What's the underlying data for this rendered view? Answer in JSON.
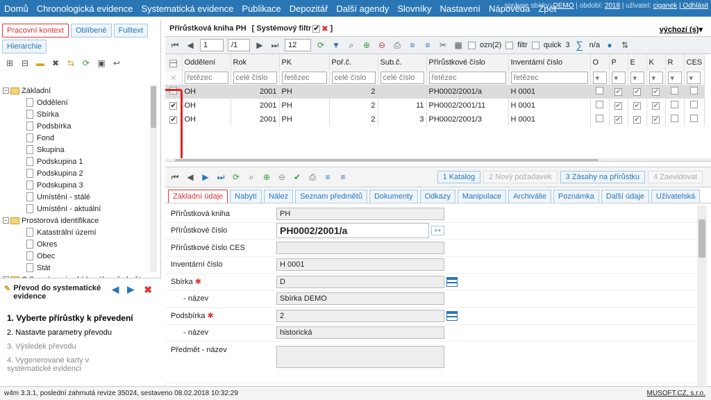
{
  "nav": {
    "items": [
      "Domů",
      "Chronologická evidence",
      "Systematická evidence",
      "Publikace",
      "Depozitář",
      "Další agendy",
      "Slovníky",
      "Nastavení",
      "Nápověda",
      "Zpět"
    ],
    "user_prefix": "správce sbírky:",
    "user_account": "DEMO",
    "period_prefix": "| období:",
    "period": "2018",
    "login_prefix": "| uživatel:",
    "login": "ciganek",
    "logout": "| Odhlásit",
    "default_link": "výchozí (s)"
  },
  "left_tabs": [
    "Pracovní kontext",
    "Oblíbené",
    "Fulltext",
    "Hierarchie"
  ],
  "tree": {
    "root_label": "Základní",
    "root_items": [
      "Oddělení",
      "Sbírka",
      "Podsbírka",
      "Fond",
      "Skupina",
      "Podskupina 1",
      "Podskupina 2",
      "Podskupina 3",
      "Umístění - stálé",
      "Umístění - aktuální"
    ],
    "geo_label": "Prostorová identifikace",
    "geo_items": [
      "Katastrální území",
      "Okres",
      "Obec",
      "Stát"
    ],
    "cut_label": "Odborný popis sbírkového předmětu"
  },
  "wizard": {
    "title": "Převod do systematické evidence",
    "steps": [
      "1. Vyberte přírůstky k převedení",
      "2. Nastavte parametry převodu",
      "3. Výsledek převodu",
      "4. Vygenerované karty v systematické evidenci"
    ]
  },
  "panel": {
    "title": "Přírůstková kniha PH",
    "filter_label": "[ Systémový filtr",
    "filter_end": "]"
  },
  "pager": {
    "page": "1",
    "total": "/1",
    "size": "12",
    "ozn": "ozn(2)",
    "filtr": "filtr",
    "quick": "quick",
    "count": "3",
    "na": "n/a"
  },
  "grid": {
    "columns": [
      "Oddělení",
      "Rok",
      "PK",
      "Poř.č.",
      "Sub.č.",
      "Přírůstkové číslo",
      "Inventární číslo",
      "O",
      "P",
      "E",
      "K",
      "R",
      "CES"
    ],
    "filters": [
      "řetězec",
      "celé číslo",
      "řetězec",
      "celé číslo",
      "celé číslo",
      "řetězec",
      "řetězec"
    ],
    "rows": [
      {
        "checked": false,
        "sel": true,
        "cells": [
          "OH",
          "2001",
          "PH",
          "2",
          "",
          "PH0002/2001/a",
          "H 0001"
        ],
        "flags": [
          false,
          true,
          true,
          true,
          false,
          false
        ]
      },
      {
        "checked": true,
        "sel": false,
        "cells": [
          "OH",
          "2001",
          "PH",
          "2",
          "11",
          "PH0002/2001/11",
          "H 0001"
        ],
        "flags": [
          false,
          true,
          true,
          true,
          false,
          false
        ]
      },
      {
        "checked": true,
        "sel": false,
        "cells": [
          "OH",
          "2001",
          "PH",
          "2",
          "3",
          "PH0002/2001/3",
          "H 0001"
        ],
        "flags": [
          false,
          true,
          true,
          true,
          false,
          false
        ]
      }
    ]
  },
  "bottom_tabs": [
    "1 Katalog",
    "2 Nový požadavek",
    "3 Zásahy na přírůstku",
    "4 Zaevidovat"
  ],
  "form_tabs": [
    "Základní údaje",
    "Nabytí",
    "Nález",
    "Seznam předmětů",
    "Dokumenty",
    "Odkazy",
    "Manipulace",
    "Archiválie",
    "Poznámka",
    "Další údaje",
    "Uživatelská"
  ],
  "form": [
    {
      "label": "Přírůstková kniha",
      "value": "PH"
    },
    {
      "label": "Přírůstkové číslo",
      "value": "PH0002/2001/a",
      "big": true
    },
    {
      "label": "Přírůstkové číslo CES",
      "value": ""
    },
    {
      "label": "Inventární číslo",
      "value": "H 0001"
    },
    {
      "label": "Sbírka",
      "value": "D",
      "req": true,
      "pick": true
    },
    {
      "label": "- název",
      "value": "Sbírka DEMO",
      "sub": true
    },
    {
      "label": "Podsbírka",
      "value": "2",
      "req": true,
      "pick": true
    },
    {
      "label": "- název",
      "value": "historická",
      "sub": true
    },
    {
      "label": "Předmět - název",
      "value": "",
      "area": true
    }
  ],
  "footer": {
    "left": "w4m 3.3.1, poslední zahrnutá revize 35024, sestaveno 08.02.2018 10:32:29",
    "right": "MUSOFT.CZ, s.r.o."
  },
  "colors": {
    "nav": "#2a76b5",
    "accent_red": "#d33",
    "link": "#2a76b5"
  }
}
